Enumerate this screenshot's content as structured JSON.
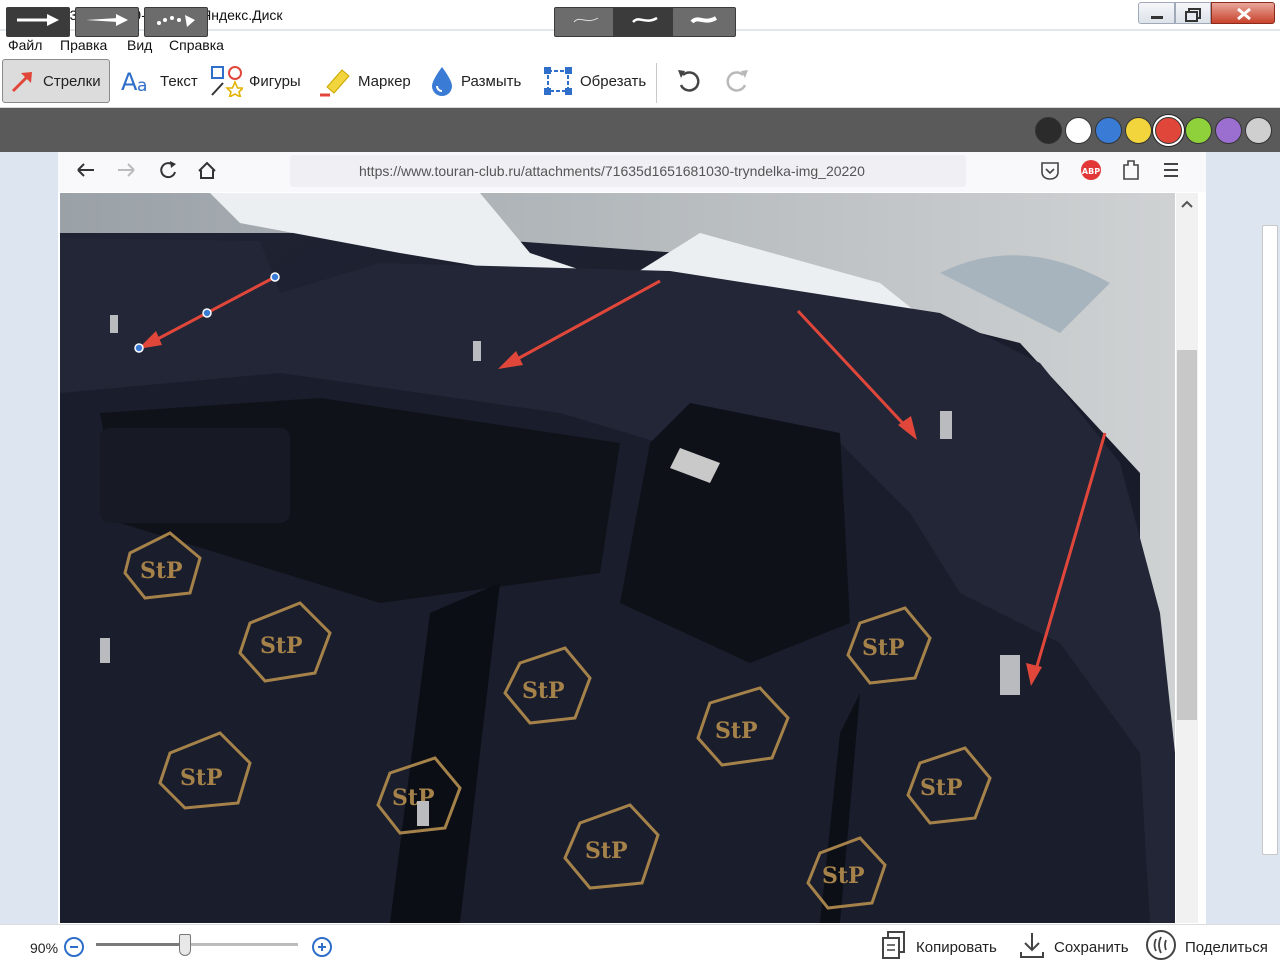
{
  "window": {
    "title": "2024-03-22_22-09-44.png - Яндекс.Диск"
  },
  "menu": [
    "Файл",
    "Правка",
    "Вид",
    "Справка"
  ],
  "tools": [
    {
      "label": "Стрелки",
      "icon": "arrow-tool-icon",
      "active": true
    },
    {
      "label": "Текст",
      "icon": "text-tool-icon",
      "active": false
    },
    {
      "label": "Фигуры",
      "icon": "shapes-tool-icon",
      "active": false
    },
    {
      "label": "Маркер",
      "icon": "marker-tool-icon",
      "active": false
    },
    {
      "label": "Размыть",
      "icon": "blur-tool-icon",
      "active": false
    },
    {
      "label": "Обрезать",
      "icon": "crop-tool-icon",
      "active": false
    }
  ],
  "palette": {
    "colors": [
      "#2b2b2b",
      "#ffffff",
      "#3a7bd5",
      "#f2d43c",
      "#e0473a",
      "#8fd13a",
      "#9b6fd0",
      "#cfcfcf"
    ],
    "selected": "#e0473a"
  },
  "browser": {
    "url": "https://www.touran-club.ru/attachments/71635d1651681030-tryndelka-img_20220"
  },
  "photo_labels": [
    "StP",
    "StP",
    "StP",
    "StP",
    "StP",
    "StP",
    "StP",
    "StP",
    "StP",
    "StP"
  ],
  "status": {
    "zoom": "90%",
    "zoom_fraction": 0.44,
    "copy": "Копировать",
    "save": "Сохранить",
    "share": "Поделиться"
  },
  "colors": {
    "accent": "#2f6fc9",
    "arrow": "#e0473a"
  }
}
